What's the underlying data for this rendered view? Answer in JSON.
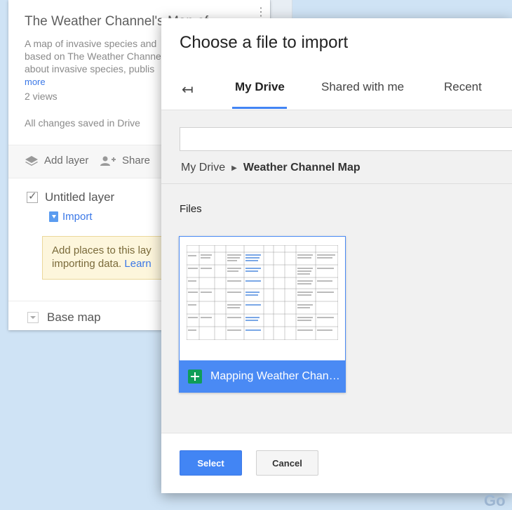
{
  "panel": {
    "map_title": "The Weather Channel's Map of",
    "description_lines": [
      "A map of invasive species and",
      "based on The Weather Channel",
      "about invasive species, publis"
    ],
    "more_link": "more",
    "views": "2 views",
    "saved_status": "All changes saved in Drive",
    "toolbar": {
      "add_layer": "Add layer",
      "share": "Share"
    },
    "layer": {
      "name": "Untitled layer",
      "import_label": "Import"
    },
    "hint": {
      "line1": "Add places to this lay",
      "line2_text": "importing data.",
      "line2_link": "Learn"
    },
    "base_map": "Base map"
  },
  "dialog": {
    "title": "Choose a file to import",
    "tabs": [
      {
        "label": "My Drive",
        "active": true
      },
      {
        "label": "Shared with me",
        "active": false
      },
      {
        "label": "Recent",
        "active": false
      }
    ],
    "search_placeholder": "",
    "breadcrumb": {
      "root": "My Drive",
      "current": "Weather Channel Map"
    },
    "files_label": "Files",
    "file": {
      "name": "Mapping Weather Chan…",
      "type_icon": "google-sheets-icon"
    },
    "select_button": "Select",
    "cancel_button": "Cancel"
  },
  "map_logo": "Go",
  "colors": {
    "accent": "#4285f4",
    "sheets_green": "#0f9d58",
    "map_water": "#cfe3f5"
  }
}
